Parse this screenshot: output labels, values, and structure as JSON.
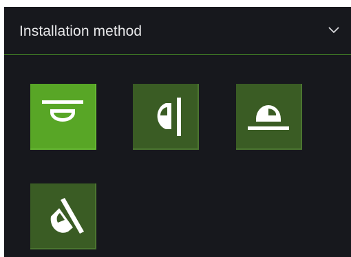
{
  "section": {
    "title": "Installation method",
    "expand_icon": "chevron-down-icon"
  },
  "methods": [
    {
      "icon": "ceiling-dome-mount-icon",
      "selected": true
    },
    {
      "icon": "wall-mount-icon",
      "selected": false
    },
    {
      "icon": "floor-dome-mount-icon",
      "selected": false
    },
    {
      "icon": "angled-wall-mount-icon",
      "selected": false
    }
  ],
  "colors": {
    "background": "#17181d",
    "accent_selected": "#58a626",
    "tile": "#3a5c24",
    "divider": "#3f7a25",
    "text": "#e8e8ea"
  }
}
